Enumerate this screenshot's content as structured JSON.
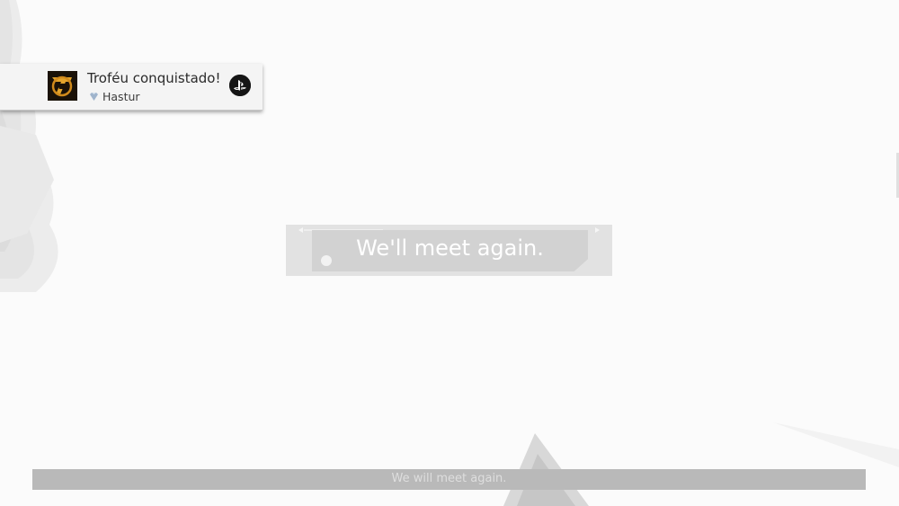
{
  "trophy_notification": {
    "title": "Troféu conquistado!",
    "trophy_name": "Hastur",
    "trophy_grade_icon": "platinum-trophy-icon",
    "game_icon": "game-emblem-icon",
    "platform_icon": "playstation-logo-icon"
  },
  "dialogue_choice": {
    "text": "We'll meet again."
  },
  "subtitle": {
    "text": "We will meet again."
  },
  "colors": {
    "background": "#fbfbfb",
    "choice_box": "#e2e2e2",
    "subtitle_bar": "#b9b9b9",
    "notification_bg": "#f4f4f4"
  }
}
